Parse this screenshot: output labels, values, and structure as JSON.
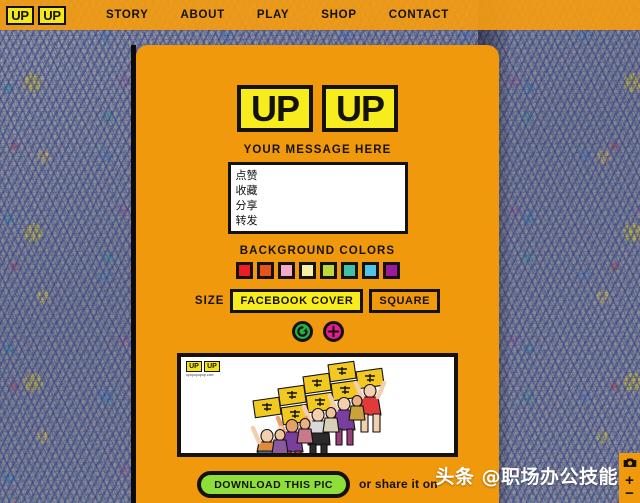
{
  "navbar": {
    "logo": {
      "left": "UP",
      "right": "UP"
    },
    "links": [
      {
        "label": "STORY",
        "name": "nav-link-story"
      },
      {
        "label": "ABOUT",
        "name": "nav-link-about"
      },
      {
        "label": "PLAY",
        "name": "nav-link-play"
      },
      {
        "label": "SHOP",
        "name": "nav-link-shop"
      },
      {
        "label": "CONTACT",
        "name": "nav-link-contact"
      }
    ]
  },
  "panel": {
    "brand": {
      "left": "UP",
      "right": "UP"
    },
    "message": {
      "label": "YOUR MESSAGE HERE",
      "value": "点赞\n收藏\n分享\n转发",
      "placeholder": ""
    },
    "background_colors": {
      "label": "BACKGROUND COLORS",
      "swatches": [
        {
          "name": "swatch-red",
          "hex": "#ee1c25"
        },
        {
          "name": "swatch-orange",
          "hex": "#e8531c"
        },
        {
          "name": "swatch-pink",
          "hex": "#f5a8c8"
        },
        {
          "name": "swatch-cream",
          "hex": "#f5f0a8"
        },
        {
          "name": "swatch-lime",
          "hex": "#bcd93c"
        },
        {
          "name": "swatch-teal",
          "hex": "#3fc2a8"
        },
        {
          "name": "swatch-sky",
          "hex": "#4fc3e8"
        },
        {
          "name": "swatch-purple",
          "hex": "#9c1a9c"
        }
      ]
    },
    "size": {
      "label": "SIZE",
      "options": [
        {
          "label": "FACEBOOK COVER",
          "selected": true
        },
        {
          "label": "SQUARE",
          "selected": false
        }
      ]
    },
    "actions": [
      {
        "name": "reload-button",
        "icon": "reload-icon",
        "color": "#25b04a"
      },
      {
        "name": "add-button",
        "icon": "plus-circle-icon",
        "color": "#e81c8f"
      }
    ],
    "preview": {
      "logo": {
        "left": "UP",
        "right": "UP"
      },
      "url": "upupupupup.com",
      "sign_text": "点赞"
    },
    "download": {
      "button_label": "DOWNLOAD THIS PIC",
      "share_text": "or share it on"
    }
  },
  "watermark": {
    "text": "头条 @职场办公技能"
  },
  "zoom_widget": {
    "camera": "camera-icon",
    "zoom_in": "+",
    "zoom_out": "−"
  },
  "colors": {
    "panel_orange": "#f0990d",
    "brand_yellow": "#f7ec1d",
    "ink_black": "#15120b",
    "download_green": "#8ede3c"
  }
}
